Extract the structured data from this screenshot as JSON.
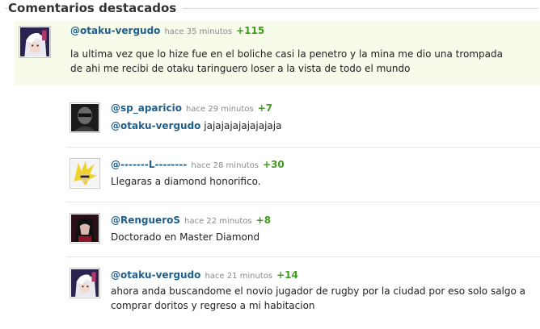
{
  "header": {
    "title": "Comentarios destacados"
  },
  "comments": [
    {
      "user": "@otaku-vergudo",
      "time": "hace 35 minutos",
      "votes": "+115",
      "lines": [
        "la ultima vez que lo hize fue en el boliche casi la penetro y la mina me dio una trompada",
        "de ahi me recibi de otaku taringuero loser a la vista de todo el mundo"
      ],
      "avatar": "anime-white-hair-avatar"
    },
    {
      "user": "@sp_aparicio",
      "time": "hace 29 minutos",
      "votes": "+7",
      "mention": "@otaku-vergudo",
      "text": "jajajajajajajajaja",
      "avatar": "dark-portrait-avatar"
    },
    {
      "user": "@-------L--------",
      "time": "hace 28 minutos",
      "votes": "+30",
      "text": "Llegaras a diamond honorifico.",
      "avatar": "yellow-spiky-hair-avatar"
    },
    {
      "user": "@RengueroS",
      "time": "hace 22 minutos",
      "votes": "+8",
      "text": "Doctorado en Master Diamond",
      "avatar": "dark-hair-red-avatar"
    },
    {
      "user": "@otaku-vergudo",
      "time": "hace 21 minutos",
      "votes": "+14",
      "lines": [
        "ahora anda buscandome el novio jugador de rugby por la ciudad por eso solo salgo a",
        "comprar doritos y regreso a mi habitacion"
      ],
      "avatar": "anime-white-hair-avatar"
    }
  ]
}
